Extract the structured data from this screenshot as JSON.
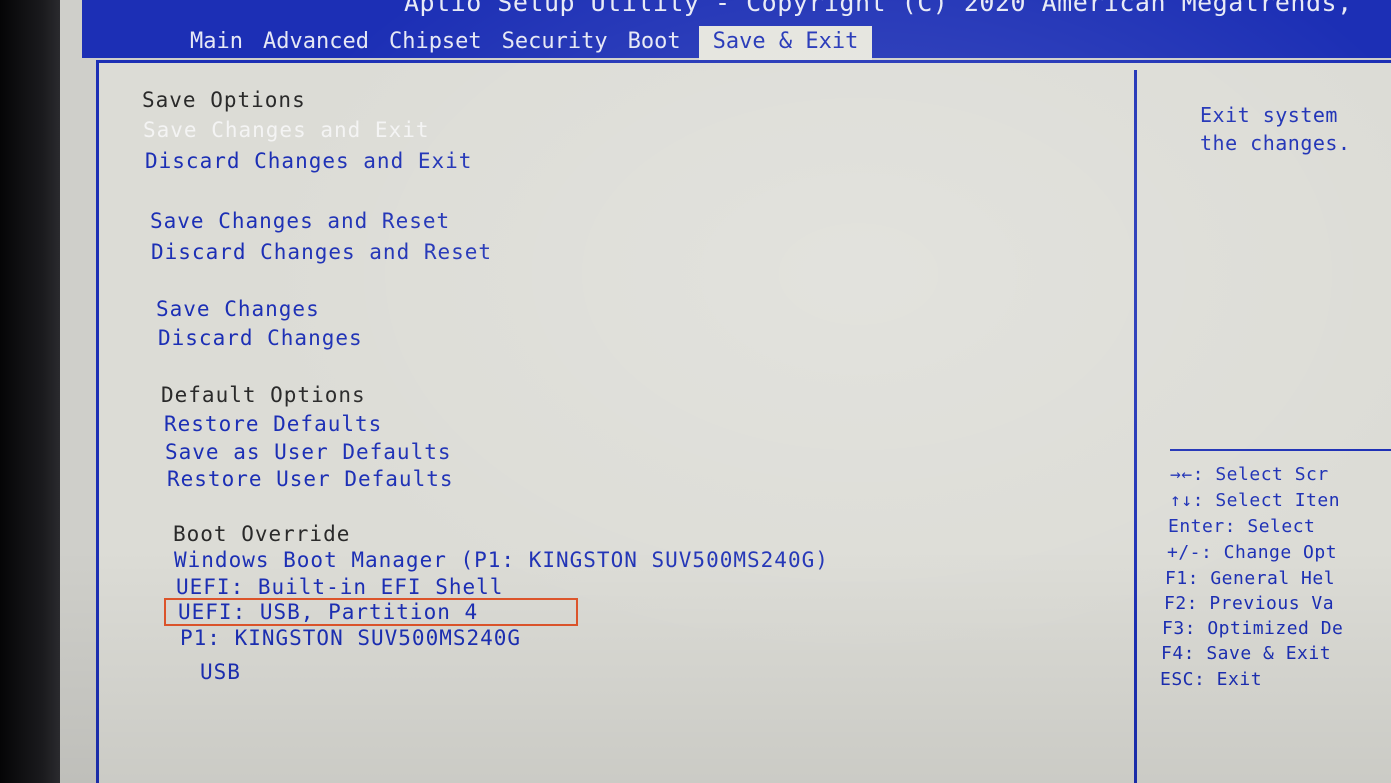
{
  "header": {
    "title": "Aptio Setup Utility - Copyright (C) 2020 American Megatrends,",
    "tabs": [
      "Main",
      "Advanced",
      "Chipset",
      "Security",
      "Boot",
      "Save & Exit"
    ],
    "active_tab": "Save & Exit"
  },
  "menu": {
    "save_options_header": "Save Options",
    "save_changes_and_exit": "Save Changes and Exit",
    "discard_changes_and_exit": "Discard Changes and Exit",
    "save_changes_and_reset": "Save Changes and Reset",
    "discard_changes_and_reset": "Discard Changes and Reset",
    "save_changes": "Save Changes",
    "discard_changes": "Discard Changes",
    "default_options_header": "Default Options",
    "restore_defaults": "Restore Defaults",
    "save_as_user_defaults": "Save as User Defaults",
    "restore_user_defaults": "Restore User Defaults",
    "boot_override_header": "Boot Override",
    "boot_items": [
      "Windows Boot Manager (P1: KINGSTON SUV500MS240G)",
      "UEFI: Built-in EFI Shell",
      "UEFI:  USB, Partition 4",
      "P1: KINGSTON SUV500MS240G",
      "USB"
    ]
  },
  "help": {
    "line1": "Exit system",
    "line2": "the changes.",
    "keys": [
      "→←: Select Scr",
      "↑↓: Select Iten",
      "Enter: Select",
      "+/-: Change Opt",
      "F1: General Hel",
      "F2: Previous Va",
      "F3: Optimized De",
      "F4: Save & Exit",
      "ESC: Exit"
    ]
  },
  "colors": {
    "bios_blue": "#1c2fb5",
    "panel_gray": "#dcdcd6",
    "highlight_red": "#e0552b",
    "selected_text": "#f4f4f4"
  }
}
